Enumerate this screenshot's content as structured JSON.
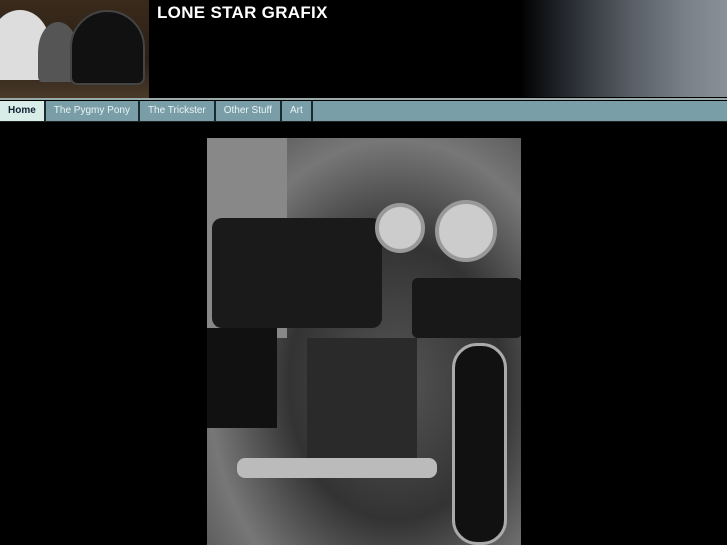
{
  "header": {
    "title": "LONE STAR GRAFIX"
  },
  "nav": {
    "items": [
      {
        "label": "Home",
        "active": true
      },
      {
        "label": "The Pygmy Pony"
      },
      {
        "label": "The Trickster"
      },
      {
        "label": "Other Stuff"
      },
      {
        "label": "Art"
      }
    ]
  },
  "colors": {
    "nav_bg": "#7a9ea8",
    "nav_active": "#d8ece8"
  }
}
